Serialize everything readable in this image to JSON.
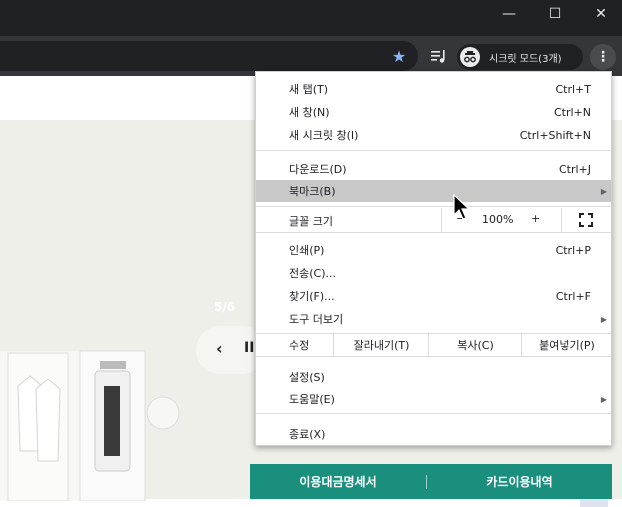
{
  "window": {
    "minimize_label": "—",
    "maximize_label": "☐",
    "close_label": "✕"
  },
  "toolbar": {
    "bookmark_icon": "star-icon",
    "incognito_label": "시크릿 모드(3개)",
    "menu_icon": "⋮"
  },
  "page": {
    "slide_counter": "5/6",
    "prev_label": "‹",
    "pause_label": "II",
    "cta_left": "이용대금명세서",
    "cta_right": "카드이용내역",
    "colors": {
      "hero": "#efefea",
      "cta": "#1b8f7d"
    }
  },
  "menu": {
    "new_tab": {
      "label": "새 탭(T)",
      "shortcut": "Ctrl+T"
    },
    "new_window": {
      "label": "새 창(N)",
      "shortcut": "Ctrl+N"
    },
    "new_incognito": {
      "label": "새 시크릿 창(I)",
      "shortcut": "Ctrl+Shift+N"
    },
    "downloads": {
      "label": "다운로드(D)",
      "shortcut": "Ctrl+J"
    },
    "bookmarks": {
      "label": "북마크(B)"
    },
    "zoom": {
      "label": "글꼴 크기",
      "minus": "−",
      "value": "100%",
      "plus": "+"
    },
    "print": {
      "label": "인쇄(P)",
      "shortcut": "Ctrl+P"
    },
    "cast": {
      "label": "전송(C)..."
    },
    "find": {
      "label": "찾기(F)...",
      "shortcut": "Ctrl+F"
    },
    "more_tools": {
      "label": "도구 더보기"
    },
    "edit": {
      "label": "수정",
      "cut": "잘라내기(T)",
      "copy": "복사(C)",
      "paste": "붙여넣기(P)"
    },
    "settings": {
      "label": "설정(S)"
    },
    "help": {
      "label": "도움말(E)"
    },
    "exit": {
      "label": "종료(X)"
    },
    "highlight_color": "#c8c8c8"
  }
}
